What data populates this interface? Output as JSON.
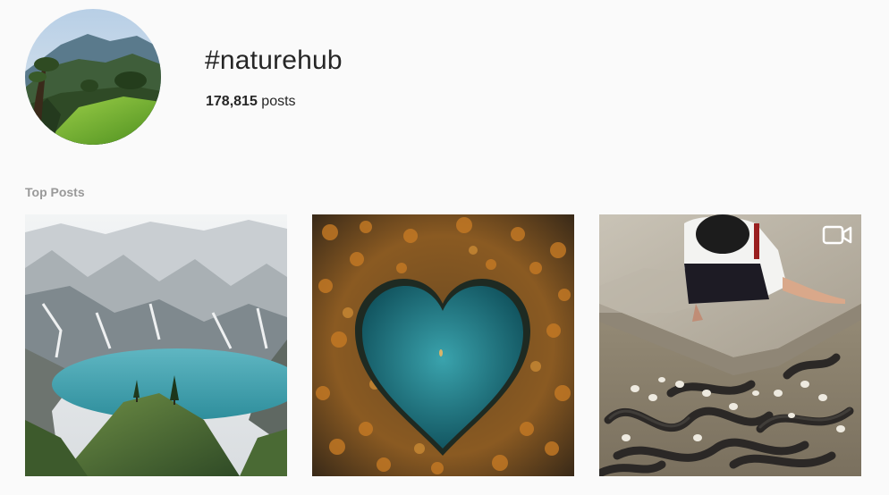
{
  "header": {
    "hashtag": "#naturehub",
    "post_count_number": "178,815",
    "post_count_label": "posts"
  },
  "sections": {
    "top_posts_label": "Top Posts"
  },
  "posts": [
    {
      "kind": "image",
      "subject": "mountain-lake"
    },
    {
      "kind": "image",
      "subject": "heart-shaped-lake"
    },
    {
      "kind": "video",
      "subject": "eels-in-pond",
      "badge_icon": "video-camera-icon"
    }
  ],
  "colors": {
    "page_background": "#fafafa",
    "primary_text": "#262626",
    "secondary_text": "#999999"
  }
}
